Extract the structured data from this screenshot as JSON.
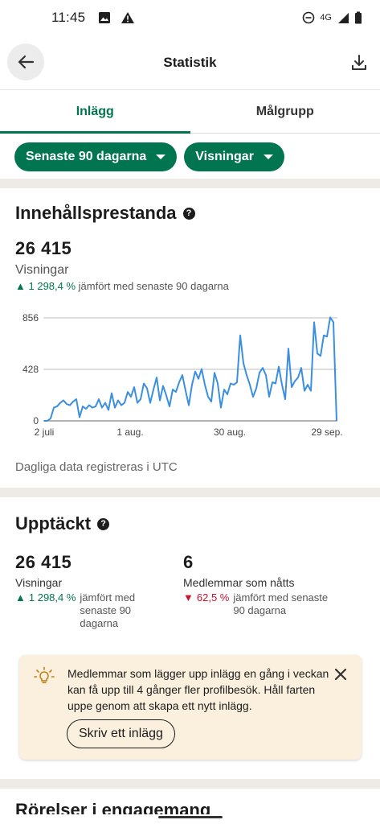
{
  "status_bar": {
    "time": "11:45",
    "network": "4G"
  },
  "app_bar": {
    "title": "Statistik"
  },
  "tabs": [
    {
      "label": "Inlägg"
    },
    {
      "label": "Målgrupp"
    }
  ],
  "filters": {
    "period": "Senaste 90 dagarna",
    "metric": "Visningar"
  },
  "content_performance": {
    "title": "Innehållsprestanda",
    "total": "26 415",
    "label": "Visningar",
    "delta_value": "1 298,4 %",
    "delta_text": "jämfört med senaste 90 dagarna",
    "footnote": "Dagliga data registreras i UTC"
  },
  "discovery": {
    "title": "Upptäckt",
    "views_total": "26 415",
    "views_label": "Visningar",
    "views_delta": "1 298,4 %",
    "views_delta_text": "jämfört med senaste 90 dagarna",
    "members_total": "6",
    "members_label": "Medlemmar som nåtts",
    "members_delta": "62,5 %",
    "members_delta_text": "jämfört med senaste 90 dagarna"
  },
  "tip": {
    "text": "Medlemmar som lägger upp inlägg en gång i veckan kan få upp till 4 gånger fler profilbesök. Håll farten uppe genom att skapa ett nytt inlägg.",
    "cta": "Skriv ett inlägg"
  },
  "next_section_title": "Rörelser i engagemang",
  "colors": {
    "accent": "#01754f",
    "line": "#3b8fe0",
    "negative": "#cb112d",
    "tip_bg": "#fbf0de"
  },
  "chart_data": {
    "type": "line",
    "x_ticks": [
      "2 juli",
      "1 aug.",
      "30 aug.",
      "29 sep."
    ],
    "y_ticks": [
      "0",
      "428",
      "856"
    ],
    "ylim": [
      0,
      856
    ],
    "series": [
      {
        "values": [
          0,
          0,
          20,
          110,
          120,
          150,
          170,
          140,
          130,
          160,
          180,
          30,
          120,
          100,
          130,
          110,
          120,
          180,
          110,
          150,
          90,
          230,
          110,
          170,
          130,
          150,
          240,
          200,
          280,
          150,
          180,
          310,
          270,
          150,
          260,
          360,
          170,
          290,
          210,
          120,
          260,
          240,
          320,
          380,
          250,
          130,
          300,
          410,
          350,
          430,
          300,
          200,
          160,
          400,
          310,
          110,
          260,
          220,
          310,
          300,
          320,
          710,
          480,
          380,
          300,
          200,
          270,
          400,
          440,
          380,
          200,
          320,
          310,
          450,
          300,
          180,
          600,
          280,
          330,
          360,
          440,
          250,
          300,
          250,
          820,
          560,
          540,
          710,
          700,
          860,
          820,
          0
        ]
      }
    ]
  }
}
